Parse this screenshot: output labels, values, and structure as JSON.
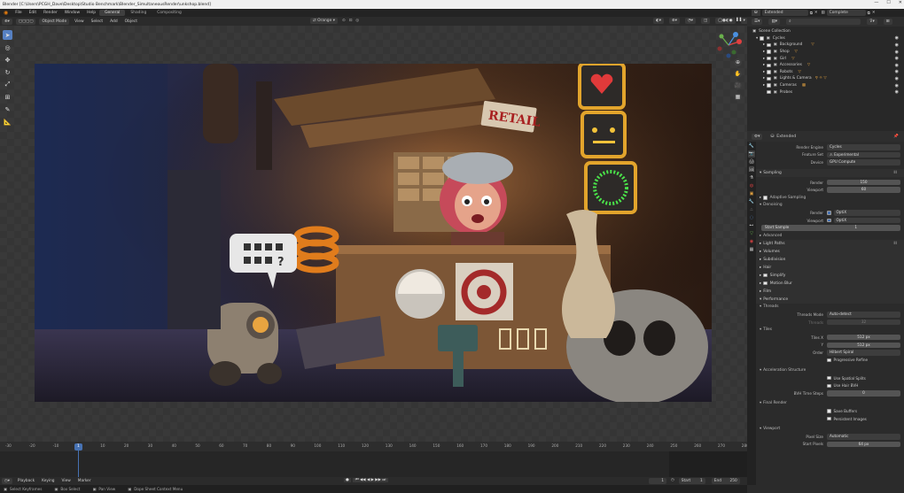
{
  "window": {
    "title": "Blender [C:\\Users\\PCGH_Dave\\Desktop\\Studio Benchmark\\Blender_SimultaneousRender\\unkshop.blend]"
  },
  "menus": [
    "File",
    "Edit",
    "Render",
    "Window",
    "Help"
  ],
  "workspaces": [
    {
      "label": "General",
      "active": true
    },
    {
      "label": "Shading",
      "active": false
    },
    {
      "label": "Compositing",
      "active": false
    }
  ],
  "scene_field": "Extended",
  "view_layer": "Complete",
  "header3d": {
    "mode": "Object Mode",
    "items": [
      "View",
      "Select",
      "Add",
      "Object"
    ],
    "transform": "Global",
    "orient": "Orange"
  },
  "outliner": {
    "search_placeholder": "",
    "root": "Scene Collection",
    "collection": "Cycles",
    "items": [
      "Background",
      "Shop",
      "Girl",
      "Accessories",
      "Robots",
      "Lights & Camera",
      "Cameras",
      "Probes"
    ]
  },
  "properties": {
    "scene_name": "Extended",
    "render_engine_label": "Render Engine",
    "render_engine": "Cycles",
    "feature_set_label": "Feature Set",
    "feature_set": "Experimental",
    "device_label": "Device",
    "device": "GPU Compute",
    "sampling": "Sampling",
    "render_label": "Render",
    "render_samples": "150",
    "viewport_label": "Viewport",
    "viewport_samples": "60",
    "adaptive_sampling": "Adaptive Sampling",
    "denoising": "Denoising",
    "denoise_render": "OptiX",
    "denoise_viewport": "OptiX",
    "start_sample_label": "Start Sample",
    "start_sample": "1",
    "advanced": "Advanced",
    "panels": [
      "Light Paths",
      "Volumes",
      "Subdivision",
      "Hair",
      "Simplify",
      "Motion Blur",
      "Film",
      "Performance"
    ],
    "threads": "Threads",
    "threads_mode_label": "Threads Mode",
    "threads_mode": "Auto-detect",
    "threads_label": "Threads",
    "threads_value": "32",
    "tiles": "Tiles",
    "tiles_x_label": "Tiles X",
    "tiles_x": "512 px",
    "tiles_y_label": "Y",
    "tiles_y": "512 px",
    "order_label": "Order",
    "order": "Hilbert Spiral",
    "progressive_refine": "Progressive Refine",
    "accel": "Acceleration Structure",
    "spatial_splits": "Use Spatial Splits",
    "hair_bvh": "Use Hair BVH",
    "bvh_steps_label": "BVH Time Steps",
    "bvh_steps": "0",
    "final_render": "Final Render",
    "save_buffers": "Save Buffers",
    "persistent_images": "Persistent Images",
    "viewport_section": "Viewport",
    "pixel_size_label": "Pixel Size",
    "pixel_size": "Automatic",
    "start_pixels_label": "Start Pixels",
    "start_pixels": "64 px"
  },
  "timeline": {
    "ticks": [
      "-30",
      "-20",
      "-10",
      "1",
      "10",
      "20",
      "30",
      "40",
      "50",
      "60",
      "70",
      "80",
      "90",
      "100",
      "110",
      "120",
      "130",
      "140",
      "150",
      "160",
      "170",
      "180",
      "190",
      "200",
      "210",
      "220",
      "230",
      "240",
      "250",
      "260",
      "270",
      "280"
    ],
    "current_frame": "1",
    "playback": "Playback",
    "keying": "Keying",
    "view": "View",
    "marker": "Marker",
    "start_label": "Start",
    "start": "1",
    "end_label": "End",
    "end": "250",
    "frame_box": "1"
  },
  "status": {
    "select": "Select Keyframes",
    "box": "Box Select",
    "pan": "Pan View",
    "context": "Dope Sheet Context Menu",
    "version": "2.90.0"
  },
  "render_scene": {
    "sign": "RETAIL",
    "speech": "?"
  }
}
